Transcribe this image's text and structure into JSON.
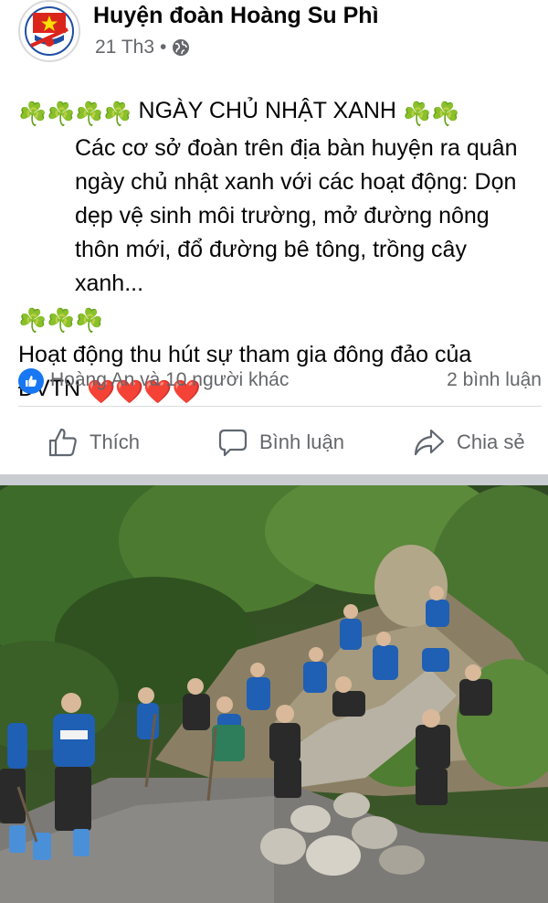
{
  "post": {
    "author": "Huyện đoàn Hoàng Su Phì",
    "date": "21 Th3",
    "separator": "•",
    "privacy_icon": "globe-icon",
    "heading": "NGÀY CHỦ NHẬT XANH",
    "body_1": "Các cơ sở đoàn trên địa bàn huyện ra quân ngày chủ nhật xanh với các hoạt động: Dọn dẹp vệ sinh môi trường, mở đường nông thôn mới, đổ đường bê tông, trồng cây xanh...",
    "body_2": "Hoạt động thu hút sự tham gia đông đảo của ĐVTN",
    "emoji_clover": "☘️",
    "emoji_heart": "❤️"
  },
  "stats": {
    "likes": "Hoàng An và 10 người khác",
    "comments": "2 bình luận"
  },
  "actions": {
    "like": "Thích",
    "comment": "Bình luận",
    "share": "Chia sẻ"
  },
  "colors": {
    "accent": "#1877f2",
    "secondary_text": "#65676b",
    "clover": "#2e9e3c",
    "heart": "#e8112d"
  }
}
